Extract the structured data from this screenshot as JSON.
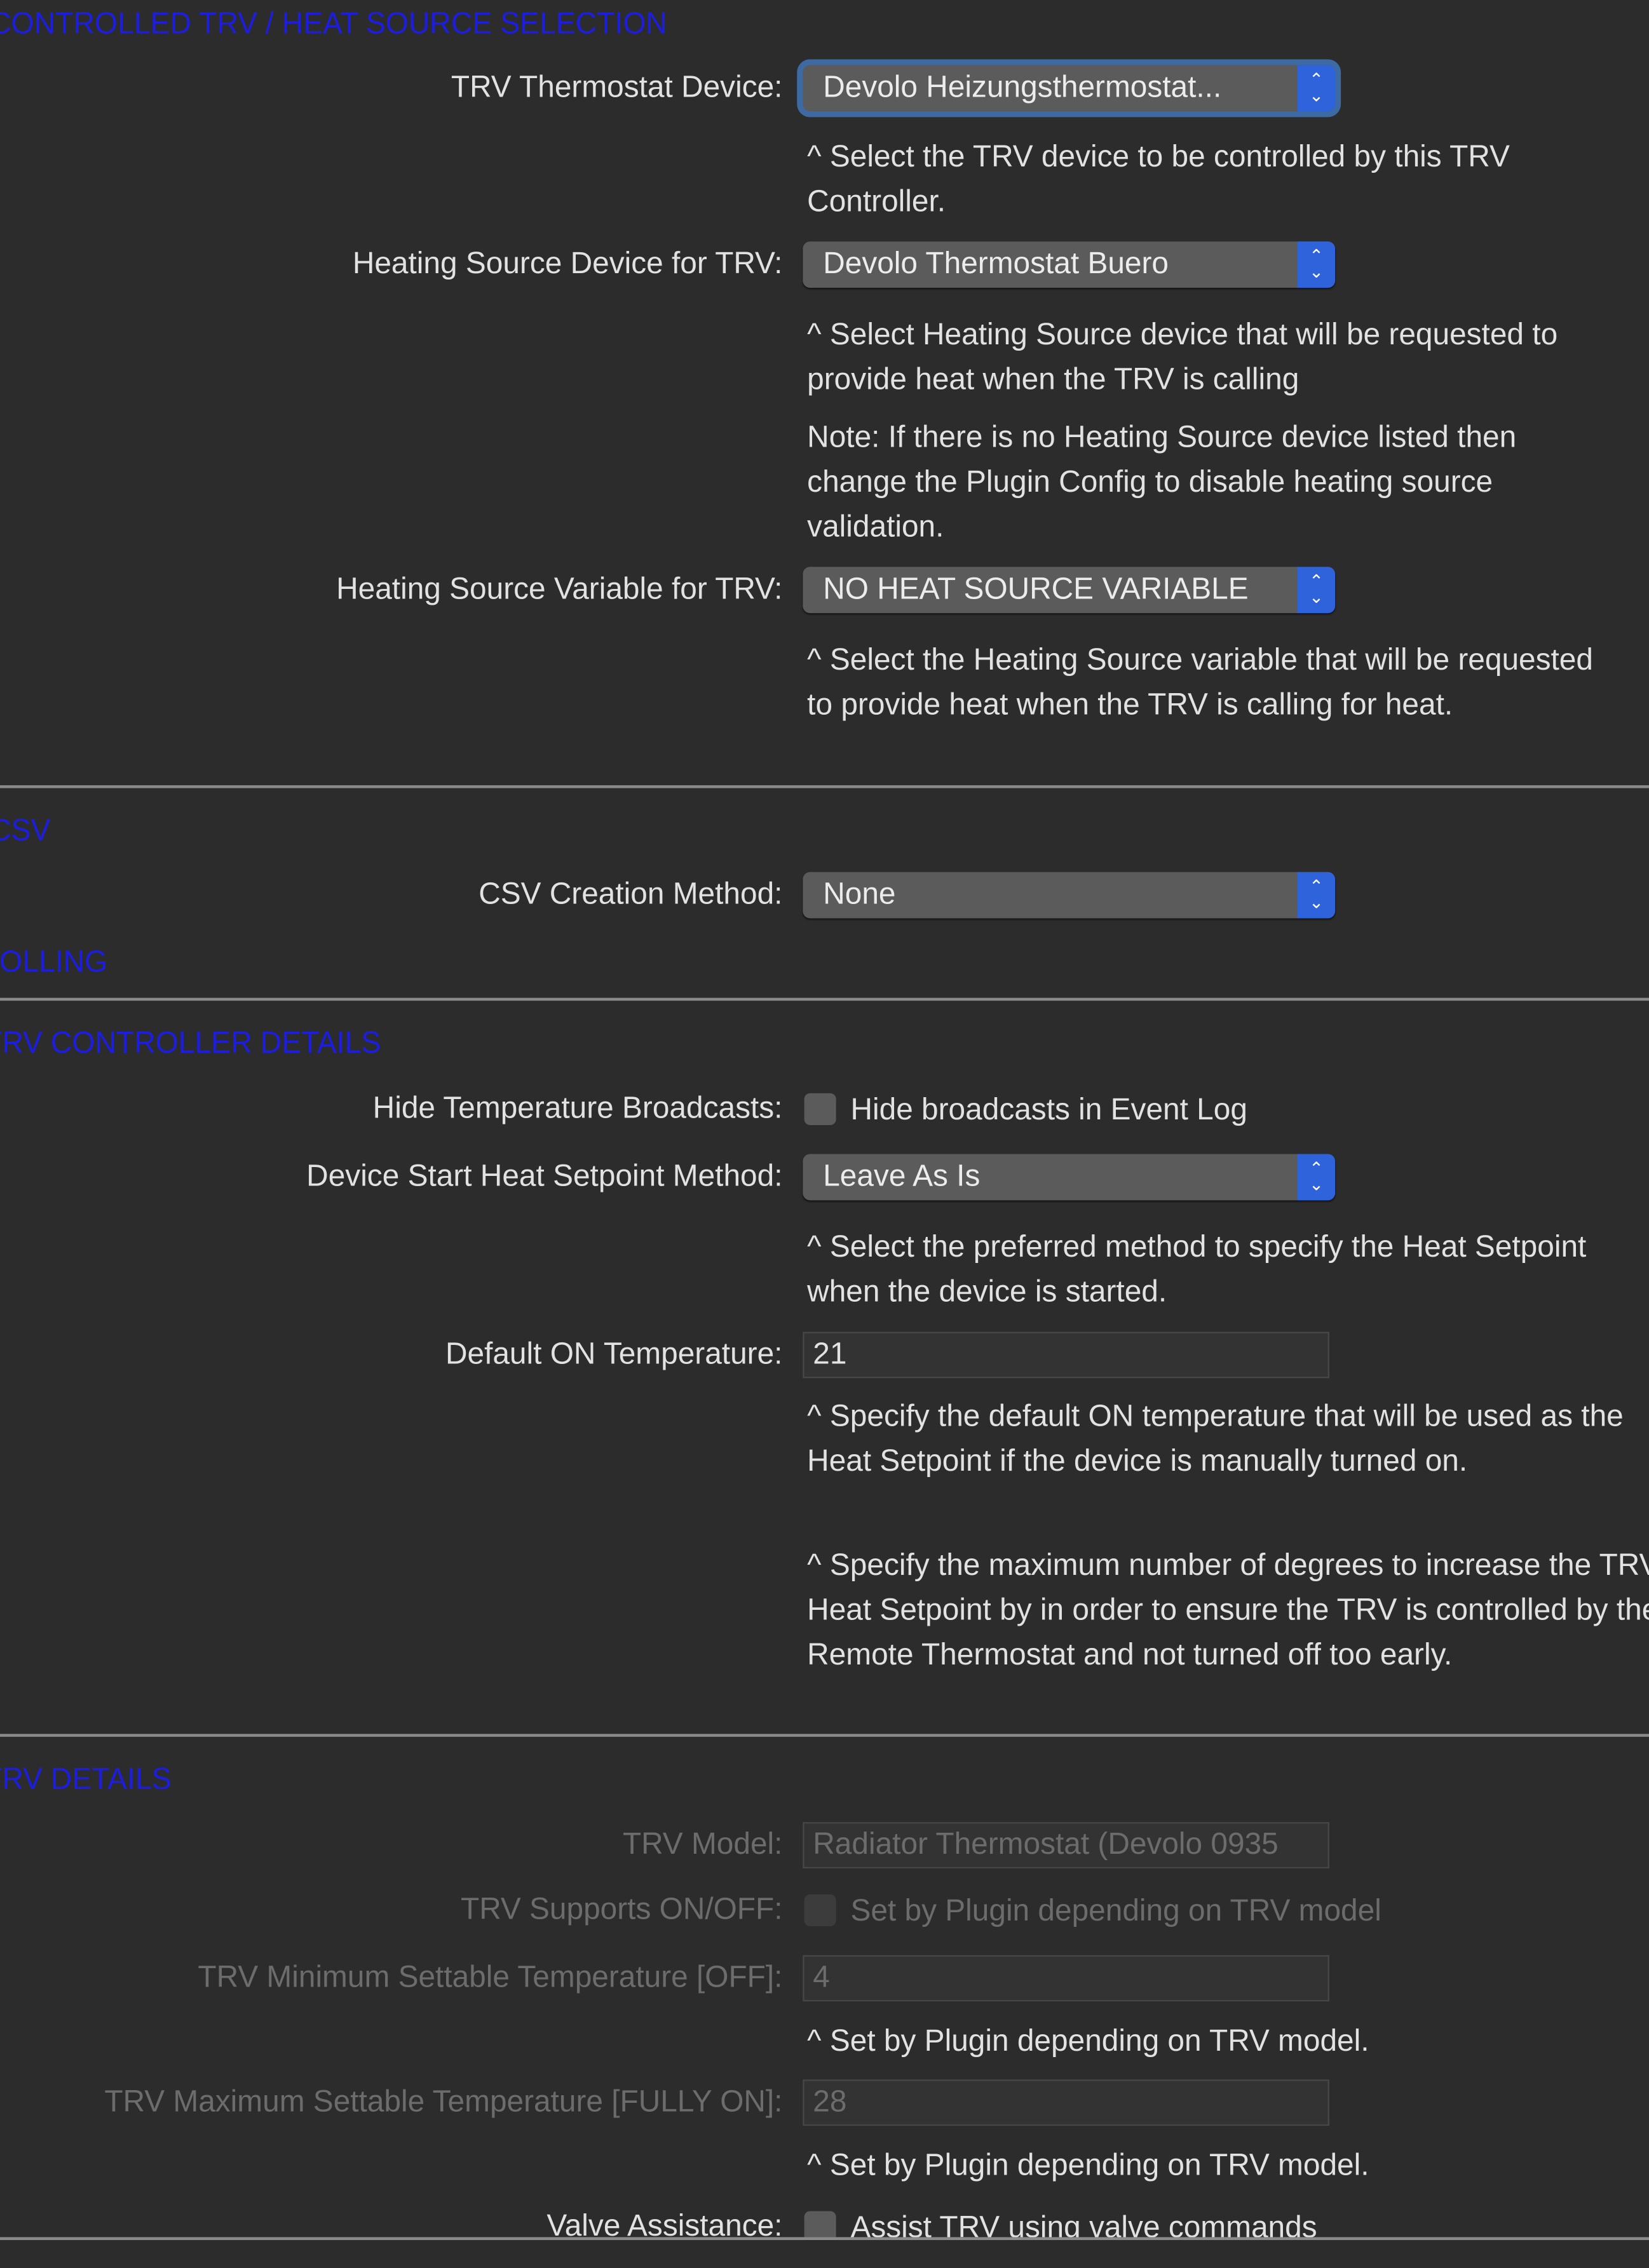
{
  "colors": {
    "background": "#2c2c2c",
    "section_heading": "#1d1de0",
    "popup_arrow": "#2f63dc",
    "focus_ring": "#3d6aa3",
    "disabled_text": "#6c6c6c"
  },
  "sections": {
    "trv_selection": "CONTROLLED TRV / HEAT SOURCE SELECTION",
    "csv": "CSV",
    "polling": "POLLING",
    "controller_details": "TRV CONTROLLER DETAILS",
    "trv_details": "TRV DETAILS"
  },
  "trv_device": {
    "label": "TRV Thermostat Device:",
    "value": "Devolo Heizungsthermostat...",
    "help": "^ Select the TRV device to be controlled by this TRV Controller."
  },
  "heating_device": {
    "label": "Heating Source Device for TRV:",
    "value": "Devolo Thermostat Buero",
    "help": "^ Select Heating Source device that will be requested to provide heat when the TRV is calling",
    "note": "Note: If there is no Heating Source device listed then change the Plugin Config to disable heating source validation."
  },
  "heating_variable": {
    "label": "Heating Source Variable for TRV:",
    "value": "NO HEAT SOURCE VARIABLE",
    "help": "^ Select the Heating Source variable that will be requested to provide heat when the TRV is calling for heat."
  },
  "csv_method": {
    "label": "CSV Creation Method:",
    "value": "None"
  },
  "hide_broadcasts": {
    "label": "Hide Temperature Broadcasts:",
    "checkbox_label": "Hide broadcasts in Event Log",
    "checked": false
  },
  "start_setpoint": {
    "label": "Device Start Heat Setpoint Method:",
    "value": "Leave As Is",
    "help": "^ Select the preferred method to specify the Heat Setpoint when the device is started."
  },
  "default_on": {
    "label": "Default ON Temperature:",
    "value": "21",
    "help": "^ Specify the default ON temperature that will be used as the Heat Setpoint if the device is manually turned on.",
    "help2": "^ Specify the maximum number of degrees to increase the TRV Heat Setpoint by in order to ensure the TRV is controlled by the Remote Thermostat and not turned off too early."
  },
  "trv_model": {
    "label": "TRV Model:",
    "value": "Radiator Thermostat (Devolo 0935"
  },
  "supports_onoff": {
    "label": "TRV Supports ON/OFF:",
    "checkbox_label": "Set by Plugin depending on TRV model",
    "checked": false
  },
  "min_temp": {
    "label": "TRV Minimum Settable Temperature [OFF]:",
    "value": "4",
    "help": "^ Set by Plugin depending on TRV model."
  },
  "max_temp": {
    "label": "TRV Maximum Settable Temperature [FULLY ON]:",
    "value": "28",
    "help": "^ Set by Plugin depending on TRV model."
  },
  "valve_assist": {
    "label": "Valve Assistance:",
    "checkbox_label": "Assist TRV using valve commands",
    "checked": false
  },
  "icons": {
    "popup_arrow": "up-down-chevron-icon"
  }
}
